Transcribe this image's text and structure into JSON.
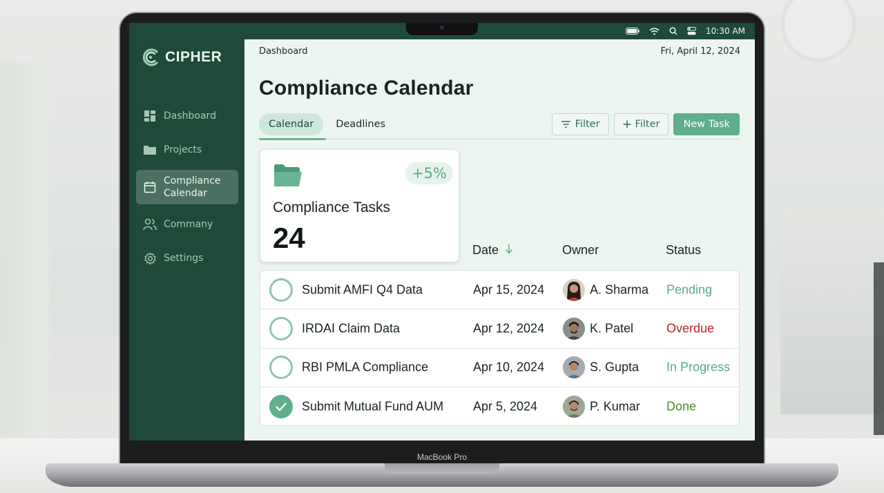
{
  "device": {
    "label": "MacBook Pro"
  },
  "menubar": {
    "time": "10:30 AM"
  },
  "brand": {
    "name": "CIPHER"
  },
  "sidebar": {
    "items": [
      {
        "label": "Dashboard",
        "icon": "dashboard-icon"
      },
      {
        "label": "Projects",
        "icon": "folder-icon"
      },
      {
        "label": "Compliance",
        "label2": "Calendar",
        "icon": "calendar-icon",
        "active": true
      },
      {
        "label": "Commany",
        "icon": "users-icon"
      },
      {
        "label": "Settings",
        "icon": "gear-icon"
      }
    ]
  },
  "header": {
    "breadcrumb": "Dashboard",
    "date": "Fri, April 12, 2024"
  },
  "page": {
    "title": "Compliance Calendar"
  },
  "tabs": [
    {
      "label": "Calendar",
      "active": true
    },
    {
      "label": "Deadlines"
    }
  ],
  "actions": {
    "filter1": "Filter",
    "filter2": "Filter",
    "new_task": "New Task"
  },
  "summary": {
    "title": "Compliance Tasks",
    "value": "24",
    "change": "+5%"
  },
  "table": {
    "columns": {
      "date": "Date",
      "owner": "Owner",
      "status": "Status"
    },
    "rows": [
      {
        "task": "Submit AMFI Q4 Data",
        "date": "Apr 15, 2024",
        "owner": "A. Sharma",
        "status": "Pending",
        "done": false
      },
      {
        "task": "IRDAI Claim Data",
        "date": "Apr 12, 2024",
        "owner": "K. Patel",
        "status": "Overdue",
        "done": false
      },
      {
        "task": "RBI PMLA Compliance",
        "date": "Apr 10, 2024",
        "owner": "S. Gupta",
        "status": "In Progress",
        "done": false
      },
      {
        "task": "Submit Mutual Fund AUM",
        "date": "Apr 5, 2024",
        "owner": "P. Kumar",
        "status": "Done",
        "done": true
      }
    ]
  },
  "colors": {
    "sidebar": "#1f4a39",
    "accent": "#5fae8c",
    "pending": "#5ba986",
    "overdue": "#b3262a",
    "in_progress": "#5ba986",
    "done": "#4f8a1f"
  }
}
